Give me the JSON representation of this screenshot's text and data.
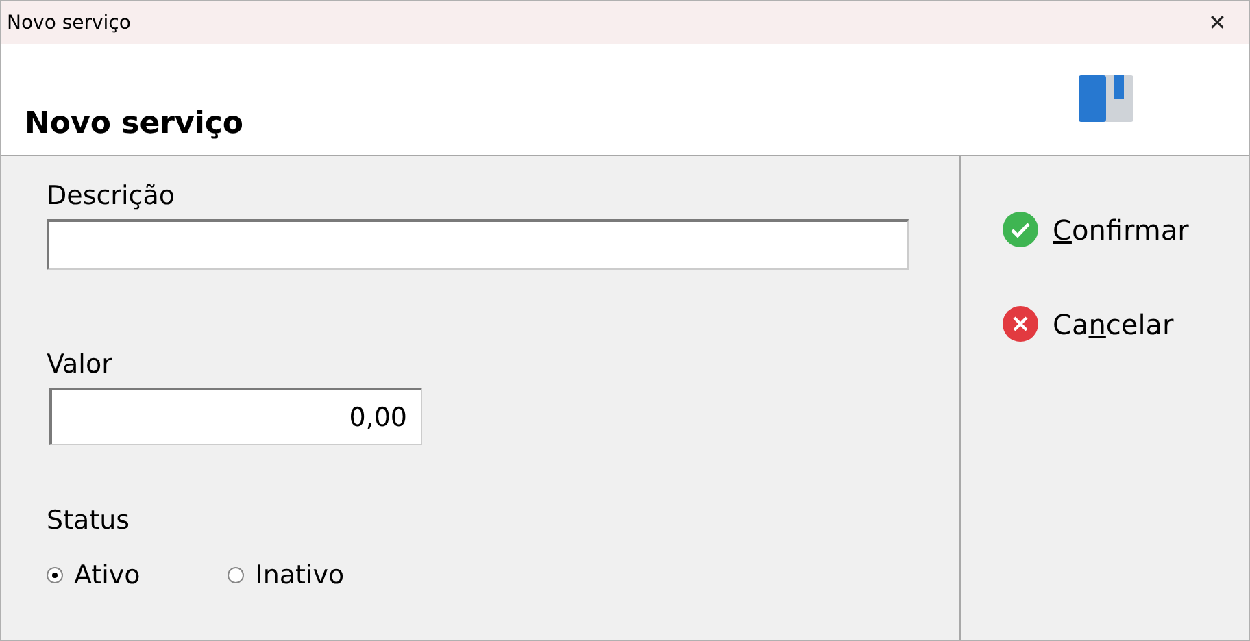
{
  "window": {
    "title": "Novo serviço",
    "close": "✕"
  },
  "header": {
    "title": "Novo serviço"
  },
  "form": {
    "description": {
      "label": "Descrição"
    },
    "value": {
      "label": "Valor",
      "value": "0,00"
    },
    "status": {
      "label": "Status",
      "options": [
        {
          "label": "Ativo",
          "selected": true
        },
        {
          "label": "Inativo",
          "selected": false
        }
      ]
    }
  },
  "actions": [
    {
      "kind": "confirm",
      "parts": [
        {
          "text": "C",
          "underlined": true
        },
        {
          "text": "onfirmar",
          "underlined": false
        }
      ]
    },
    {
      "kind": "cancel",
      "parts": [
        {
          "text": "Ca",
          "underlined": false
        },
        {
          "text": "n",
          "underlined": true
        },
        {
          "text": "celar",
          "underlined": false
        }
      ]
    }
  ]
}
